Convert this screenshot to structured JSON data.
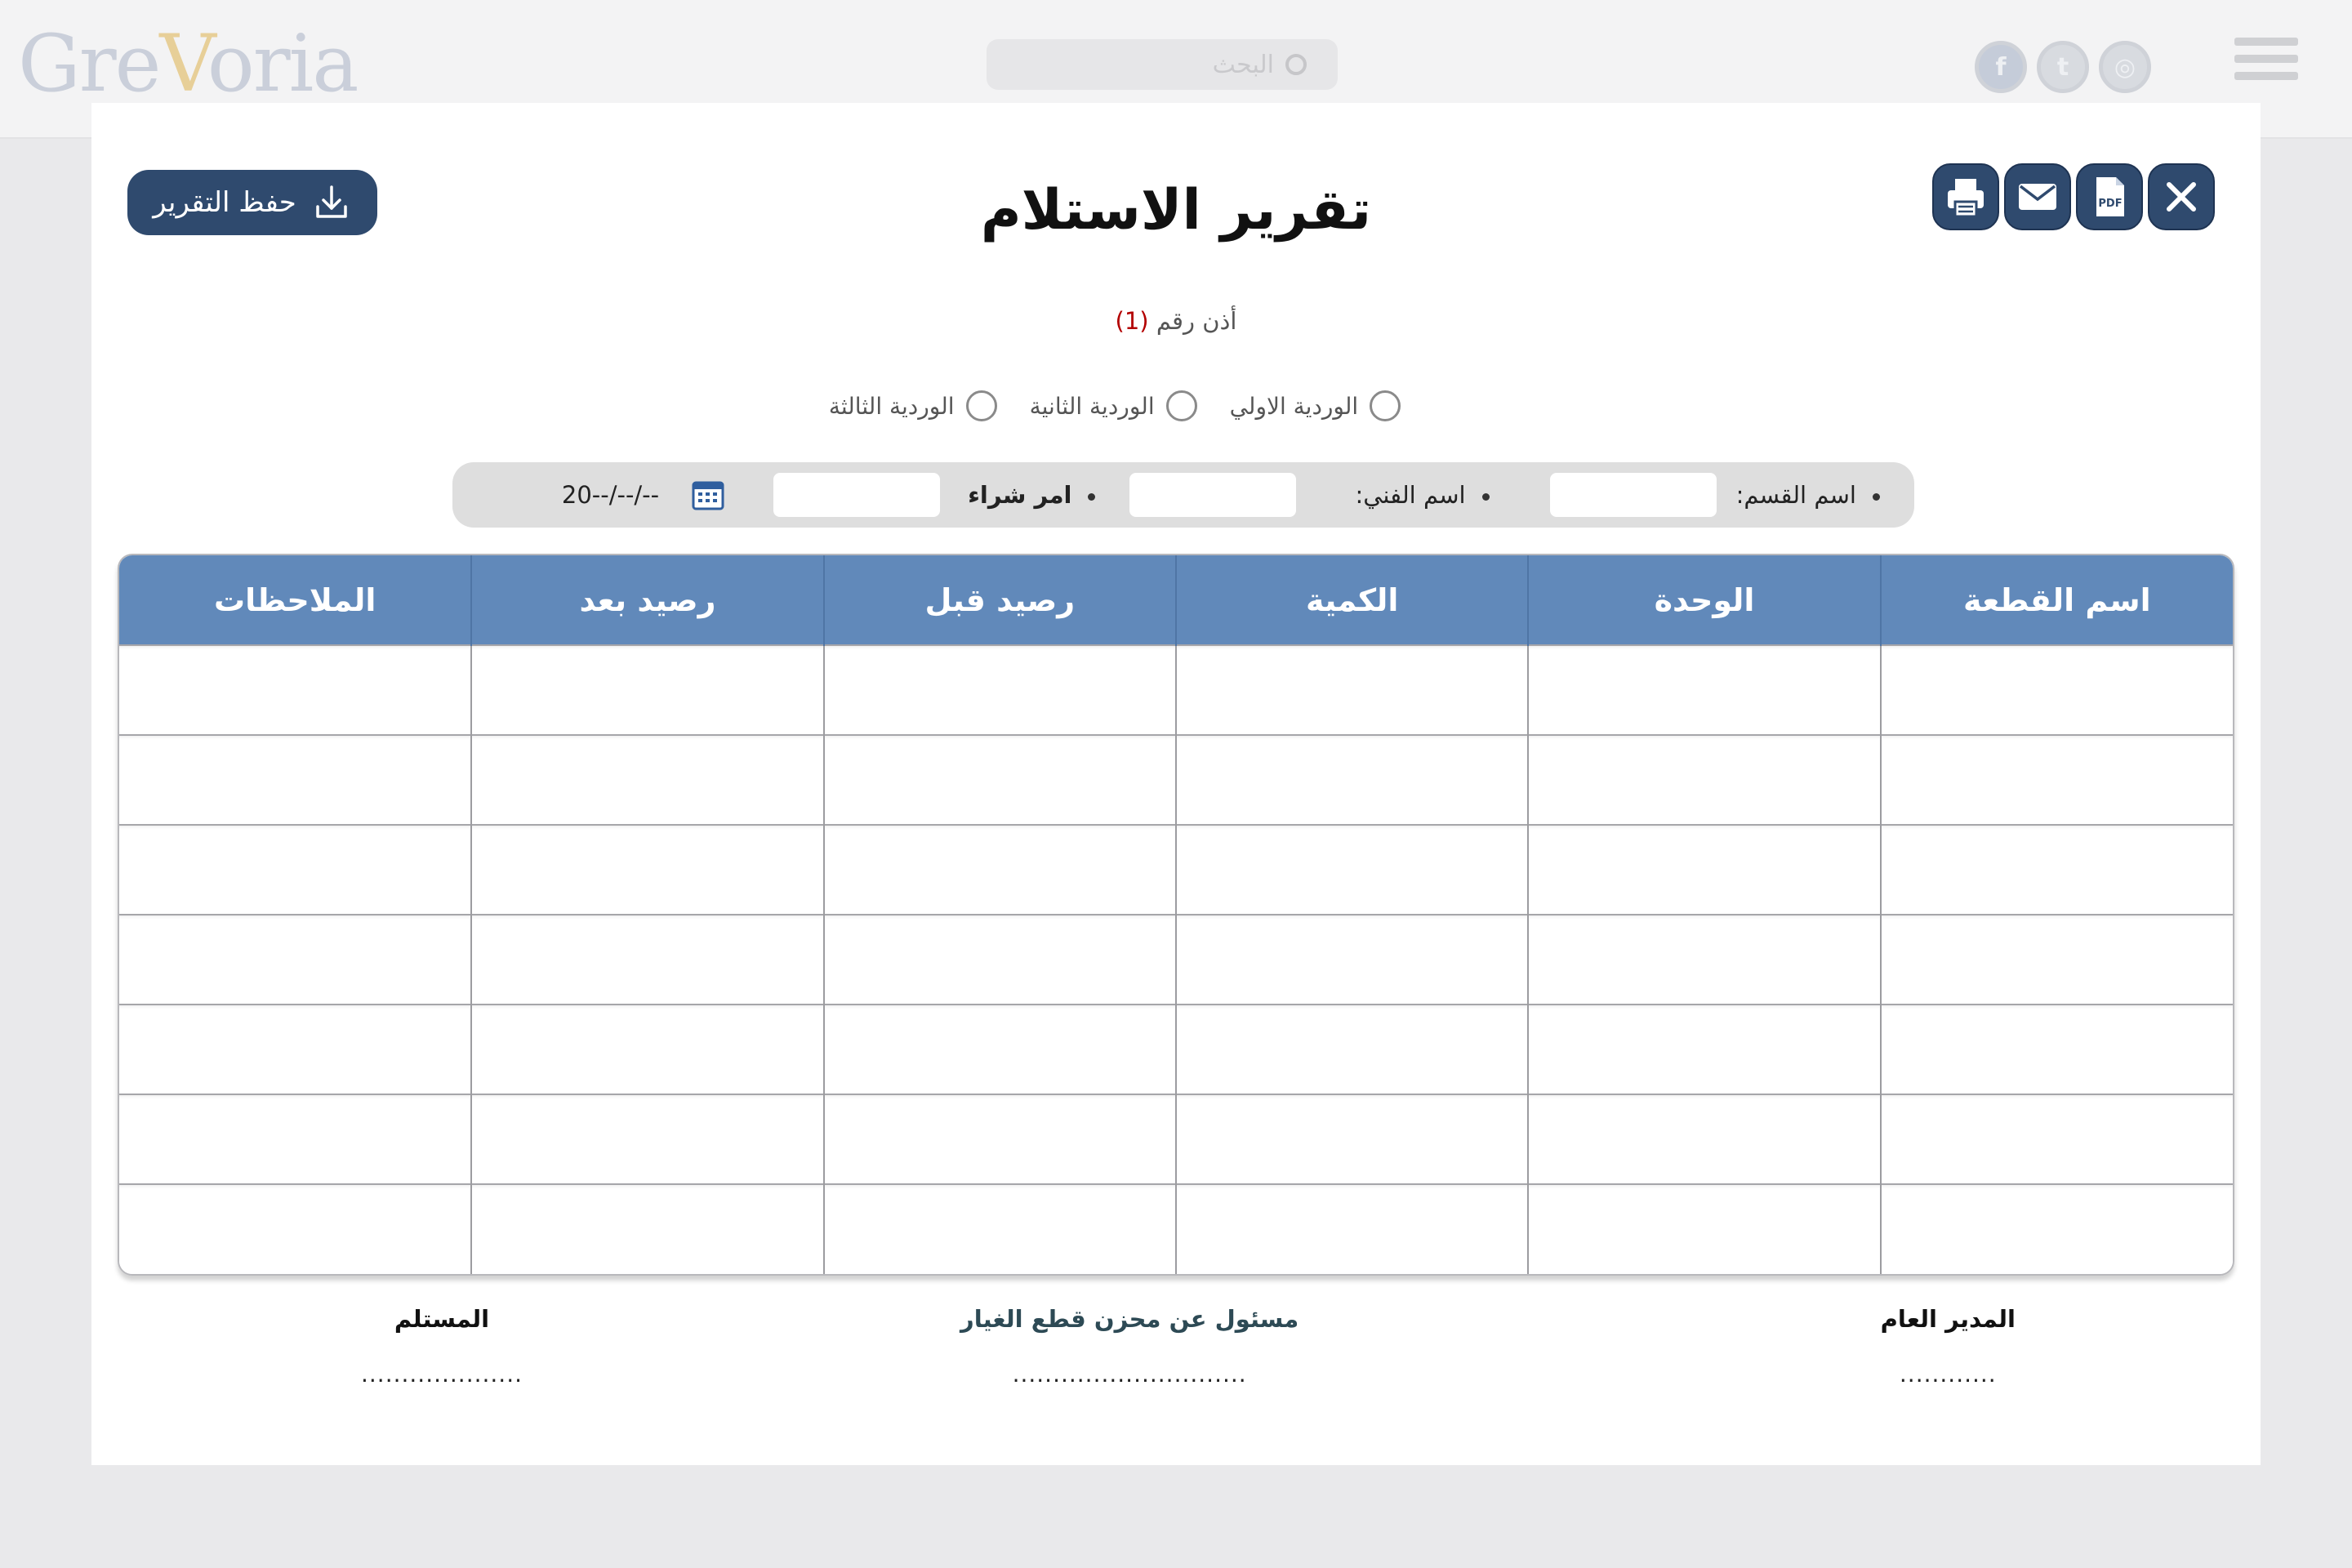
{
  "app": {
    "brand_prefix": "Gre",
    "brand_v": "V",
    "brand_suffix": "oria",
    "search_placeholder": "البحث",
    "social_icons": [
      "facebook-icon",
      "twitter-icon",
      "instagram-icon"
    ]
  },
  "dialog": {
    "title": "تقرير الاستلام",
    "save_label": "حفظ التقرير",
    "actions": [
      "print-icon",
      "email-icon",
      "pdf-icon",
      "close-icon"
    ],
    "pdf_text": "PDF",
    "permit_label": "أذن رقم",
    "permit_number": "(1)",
    "shifts": [
      "الوردية الاولي",
      "الوردية الثانية",
      "الوردية الثالثة"
    ],
    "filters": {
      "department_label": "اسم القسم:",
      "department_value": "",
      "technician_label": "اسم الفني:",
      "technician_value": "",
      "purchase_order_label": "امر شراء",
      "purchase_order_value": "",
      "date_value": "20--/--/--"
    },
    "table": {
      "columns": [
        "اسم القطعة",
        "الوحدة",
        "الكمية",
        "رصيد قبل",
        "رصيد بعد",
        "الملاحظات"
      ],
      "rows": [
        [
          "",
          "",
          "",
          "",
          "",
          ""
        ],
        [
          "",
          "",
          "",
          "",
          "",
          ""
        ],
        [
          "",
          "",
          "",
          "",
          "",
          ""
        ],
        [
          "",
          "",
          "",
          "",
          "",
          ""
        ],
        [
          "",
          "",
          "",
          "",
          "",
          ""
        ],
        [
          "",
          "",
          "",
          "",
          "",
          ""
        ],
        [
          "",
          "",
          "",
          "",
          "",
          ""
        ]
      ]
    },
    "signatures": {
      "general_manager": "المدير العام",
      "general_manager_line": "............",
      "warehouse_officer": "مسئول عن محزن قطع الغيار",
      "warehouse_officer_line": ".............................",
      "receiver": "المستلم",
      "receiver_line": "...................."
    }
  },
  "colors": {
    "primary": "#2f4a6e",
    "table_header": "#6189ba",
    "permit_number": "#b30000",
    "filter_bar": "#dedede"
  }
}
